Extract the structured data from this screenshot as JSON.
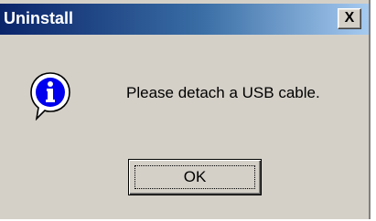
{
  "dialog": {
    "title": "Uninstall",
    "close_glyph": "X",
    "message": "Please detach a USB cable.",
    "ok_label": "OK",
    "icon": "information-icon"
  },
  "colors": {
    "titlebar_start": "#0a246a",
    "titlebar_end": "#a6caf0",
    "face": "#d4d0c8"
  }
}
